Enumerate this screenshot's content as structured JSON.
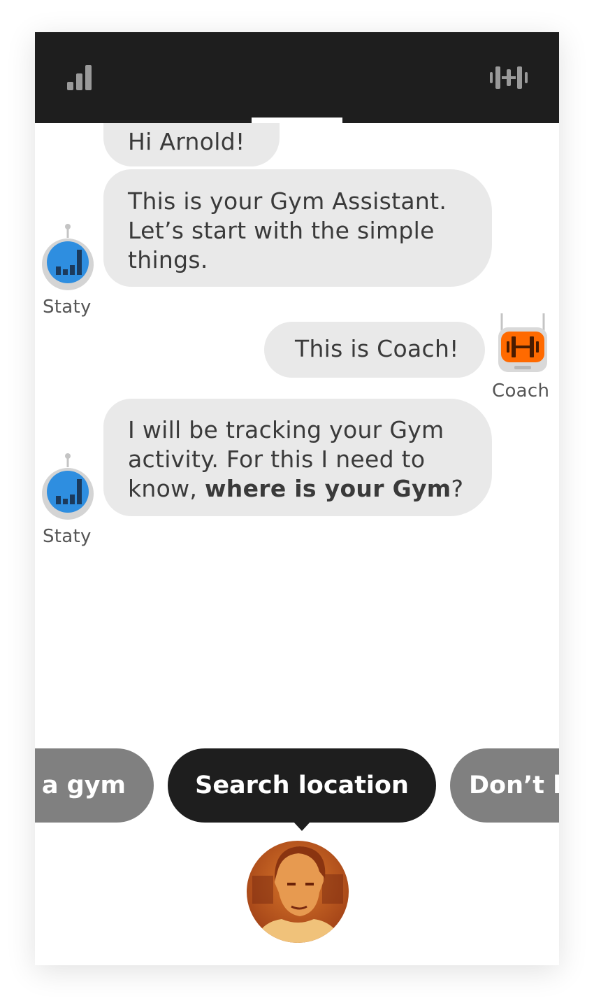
{
  "nav": {
    "tabs": [
      {
        "icon": "stats-bars-icon",
        "active": false
      },
      {
        "icon": "chat-bubbles-icon",
        "active": true
      },
      {
        "icon": "dumbbell-icon",
        "active": false
      }
    ]
  },
  "chat": {
    "messages": [
      {
        "sender": "Staty",
        "text": "Hi Arnold!"
      },
      {
        "sender": "Staty",
        "line1": "This is your Gym Assistant.",
        "line2": "Let’s start with the simple",
        "line3": "things."
      },
      {
        "sender": "Coach",
        "text": "This is Coach!"
      },
      {
        "sender": "Staty",
        "line1": "I will be tracking your Gym",
        "line2": "activity. For this I need to",
        "line3_prefix": "know, ",
        "line3_bold": "where is your Gym",
        "line3_suffix": "?"
      }
    ],
    "bots": {
      "staty_label": "Staty",
      "coach_label": "Coach"
    }
  },
  "quick_replies": {
    "left": "e a gym",
    "center": "Search location",
    "right": "Don’t h"
  },
  "colors": {
    "topbar": "#1e1e1e",
    "bubble": "#e9e9e9",
    "chip_active": "#1e1e1e",
    "chip_inactive": "#808080",
    "staty_blue": "#2e8ee0",
    "coach_orange": "#ff6a00"
  }
}
